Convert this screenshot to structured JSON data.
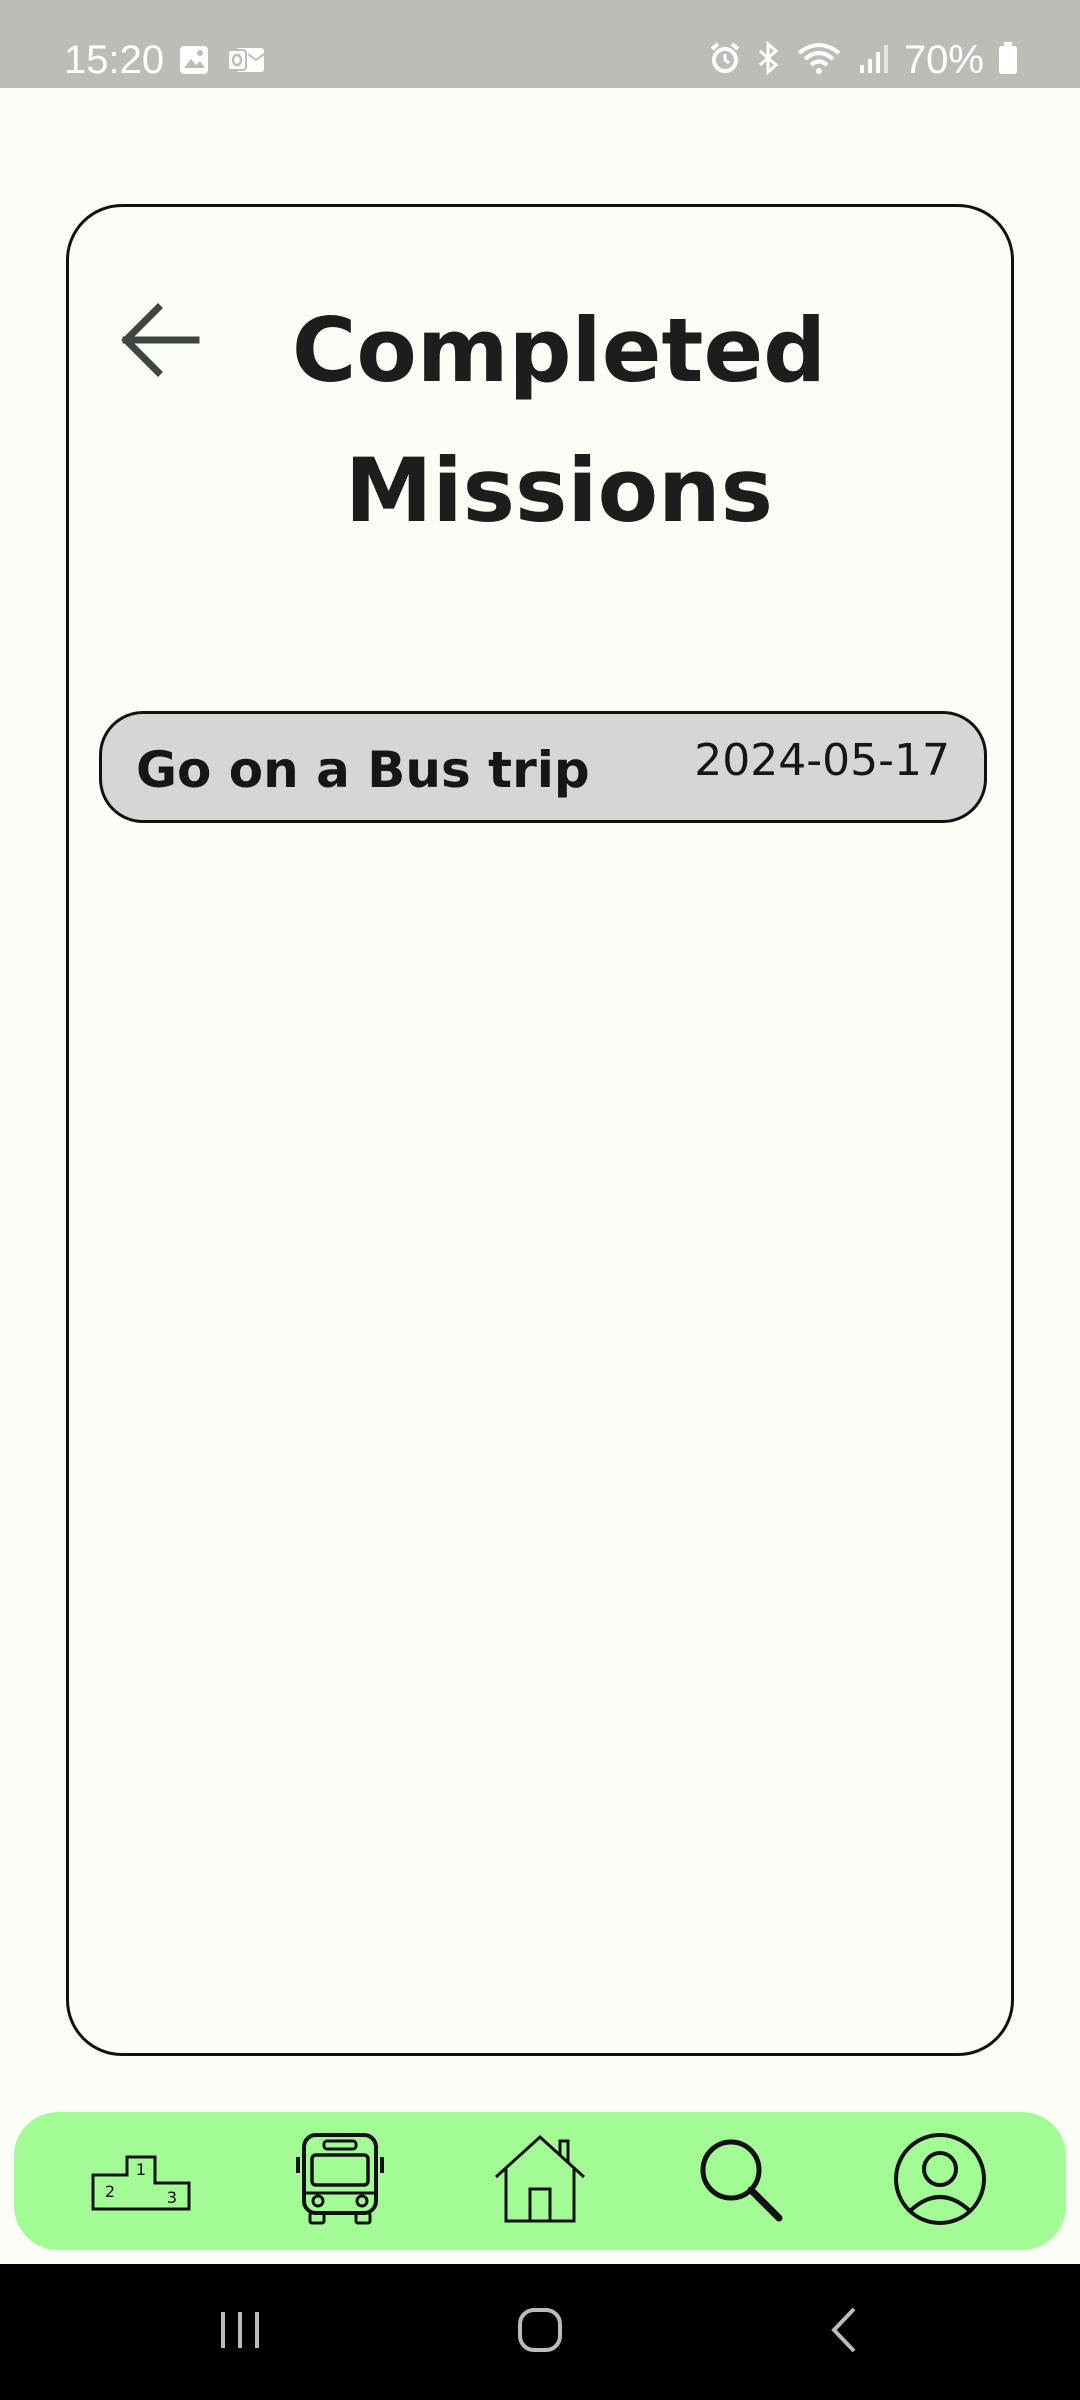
{
  "status_bar": {
    "time": "15:20",
    "battery_text": "70%",
    "icons_left": [
      "gallery-icon",
      "outlook-icon"
    ],
    "icons_right": [
      "alarm-icon",
      "bluetooth-icon",
      "wifi-icon",
      "signal-icon",
      "battery-icon"
    ]
  },
  "header": {
    "title_line1": "Completed",
    "title_line2": "Missions"
  },
  "missions": [
    {
      "name": "Go on a Bus trip",
      "date": "2024-05-17"
    }
  ],
  "bottom_nav": {
    "items": [
      "leaderboard-icon",
      "bus-icon",
      "home-icon",
      "search-icon",
      "profile-icon"
    ]
  },
  "colors": {
    "background": "#fcfdf7",
    "nav_green": "#a3fb95",
    "row_grey": "#d6d6d6",
    "status_bar": "#bdbdb8"
  }
}
